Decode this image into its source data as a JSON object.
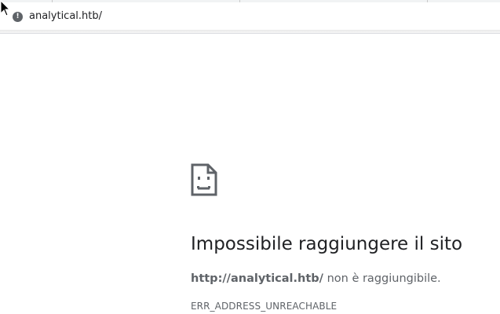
{
  "address_bar": {
    "url": "analytical.htb/",
    "info_icon": "info-icon",
    "info_glyph": "!"
  },
  "error_page": {
    "icon": "sad-page-icon",
    "title": "Impossibile raggiungere il sito",
    "host": "http://analytical.htb/",
    "message": " non è raggiungibile.",
    "error_code": "ERR_ADDRESS_UNREACHABLE"
  },
  "colors": {
    "text_primary": "#202124",
    "text_secondary": "#5f6368",
    "icon": "#5f6368"
  }
}
